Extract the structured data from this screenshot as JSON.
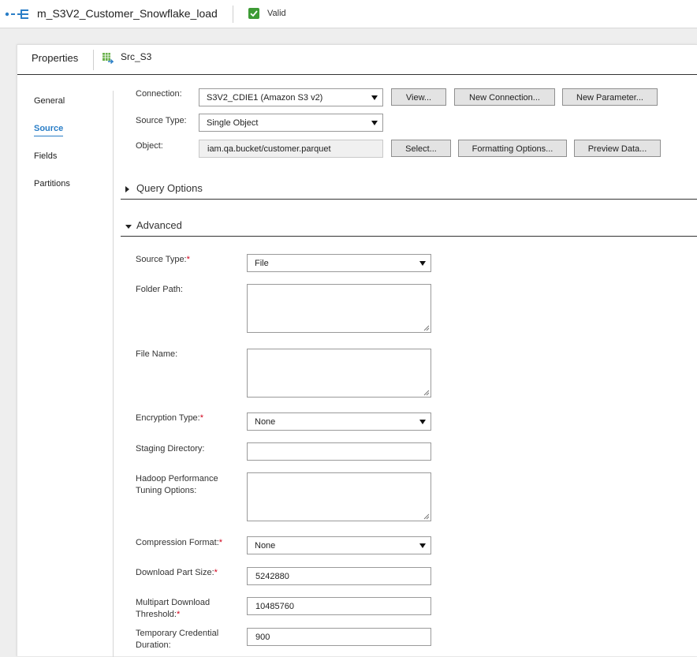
{
  "topbar": {
    "mapping_name": "m_S3V2_Customer_Snowflake_load",
    "status": "Valid",
    "status_color": "#3d9b35"
  },
  "panel": {
    "properties_label": "Properties",
    "transformation_name": "Src_S3"
  },
  "nav": {
    "items": [
      {
        "label": "General"
      },
      {
        "label": "Source"
      },
      {
        "label": "Fields"
      },
      {
        "label": "Partitions"
      }
    ],
    "active": "Source",
    "active_color": "#2a7ec7"
  },
  "source": {
    "connection_label": "Connection:",
    "connection_value": "S3V2_CDIE1 (Amazon S3 v2)",
    "source_type_label": "Source Type:",
    "source_type_value": "Single Object",
    "object_label": "Object:",
    "object_value": "iam.qa.bucket/customer.parquet",
    "buttons": {
      "view": "View...",
      "new_connection": "New Connection...",
      "new_parameter": "New Parameter...",
      "select": "Select...",
      "formatting_options": "Formatting Options...",
      "preview_data": "Preview Data..."
    }
  },
  "sections": {
    "query_options": "Query Options",
    "advanced": "Advanced"
  },
  "advanced": {
    "source_type_label": "Source Type:",
    "source_type_value": "File",
    "folder_path_label": "Folder Path:",
    "file_name_label": "File Name:",
    "encryption_type_label": "Encryption Type:",
    "encryption_type_value": "None",
    "staging_directory_label": "Staging Directory:",
    "hadoop_label_line1": "Hadoop Performance",
    "hadoop_label_line2": "Tuning Options:",
    "compression_format_label": "Compression Format:",
    "compression_format_value": "None",
    "download_part_size_label": "Download Part Size:",
    "download_part_size_value": "5242880",
    "multipart_label_line1": "Multipart Download",
    "multipart_label_line2": "Threshold:",
    "multipart_value": "10485760",
    "temp_cred_label_line1": "Temporary Credential",
    "temp_cred_label_line2": "Duration:",
    "temp_cred_value": "900",
    "required_marker": "*"
  }
}
